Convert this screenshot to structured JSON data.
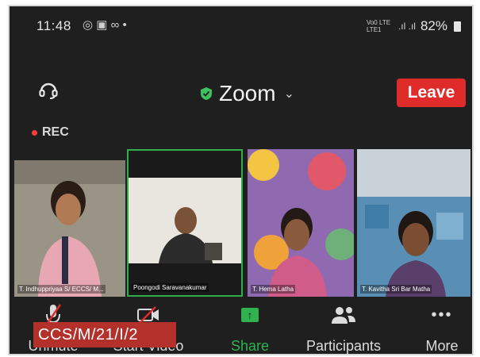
{
  "status_bar": {
    "time": "11:48",
    "notif_icons": [
      "whatsapp-icon",
      "gallery-icon",
      "voicemail-icon",
      "dot-icon"
    ],
    "network": "Vo0 LTE LTE1",
    "battery": "82%"
  },
  "header": {
    "title": "Zoom",
    "leave_label": "Leave",
    "secure_color": "#3fc05f",
    "leave_color": "#e02b2b"
  },
  "recording": {
    "label": "REC"
  },
  "participants": [
    {
      "name": "T. Indhuppriyaa S/ ECCS/ M..."
    },
    {
      "name": "Poongodi Saravanakumar",
      "active": true
    },
    {
      "name": "T. Hema Latha"
    },
    {
      "name": "T. Kavitha Sri Bar Matha"
    }
  ],
  "controls": [
    {
      "id": "unmute",
      "label": "Unmute",
      "icon": "microphone-muted-icon"
    },
    {
      "id": "start-video",
      "label": "Start Video",
      "icon": "camera-off-icon"
    },
    {
      "id": "share",
      "label": "Share",
      "icon": "share-screen-icon",
      "color": "#2fb24f"
    },
    {
      "id": "participants",
      "label": "Participants",
      "icon": "people-icon"
    },
    {
      "id": "more",
      "label": "More",
      "icon": "more-dots-icon"
    }
  ],
  "overlay_tag": "CCS/M/21/I/2"
}
